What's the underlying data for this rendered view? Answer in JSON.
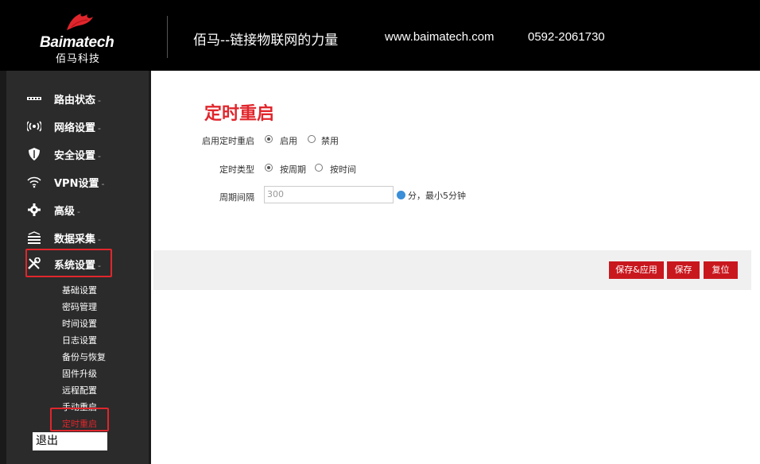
{
  "header": {
    "logo_en": "Baimatech",
    "logo_cn": "佰马科技",
    "title": "佰马--链接物联网的力量",
    "url": "www.baimatech.com",
    "phone": "0592-2061730"
  },
  "sidebar": {
    "items": [
      {
        "label": "路由状态",
        "icon": "ethernet-icon"
      },
      {
        "label": "网络设置",
        "icon": "signal-icon"
      },
      {
        "label": "安全设置",
        "icon": "shield-icon"
      },
      {
        "label": "VPN设置",
        "icon": "wifi-icon"
      },
      {
        "label": "高级",
        "icon": "gear-icon"
      },
      {
        "label": "数据采集",
        "icon": "data-collect-icon"
      },
      {
        "label": "系统设置",
        "icon": "tools-icon"
      }
    ],
    "caret": "-",
    "subitems": [
      "基础设置",
      "密码管理",
      "时间设置",
      "日志设置",
      "备份与恢复",
      "固件升级",
      "远程配置",
      "手动重启",
      "定时重启"
    ],
    "active_subitem": "定时重启",
    "logout": "退出"
  },
  "main": {
    "title": "定时重启",
    "enable": {
      "label": "启用定时重启",
      "options": [
        "启用",
        "禁用"
      ],
      "selected": "启用"
    },
    "type": {
      "label": "定时类型",
      "options": [
        "按周期",
        "按时间"
      ],
      "selected": "按周期"
    },
    "interval": {
      "label": "周期间隔",
      "value": "300",
      "help": "分，最小5分钟"
    },
    "buttons": {
      "save_apply": "保存&应用",
      "save": "保存",
      "reset": "复位"
    }
  },
  "colors": {
    "accent": "#e0262c",
    "button": "#c9171e",
    "sidebar": "#2b2b2b",
    "header": "#000000"
  }
}
